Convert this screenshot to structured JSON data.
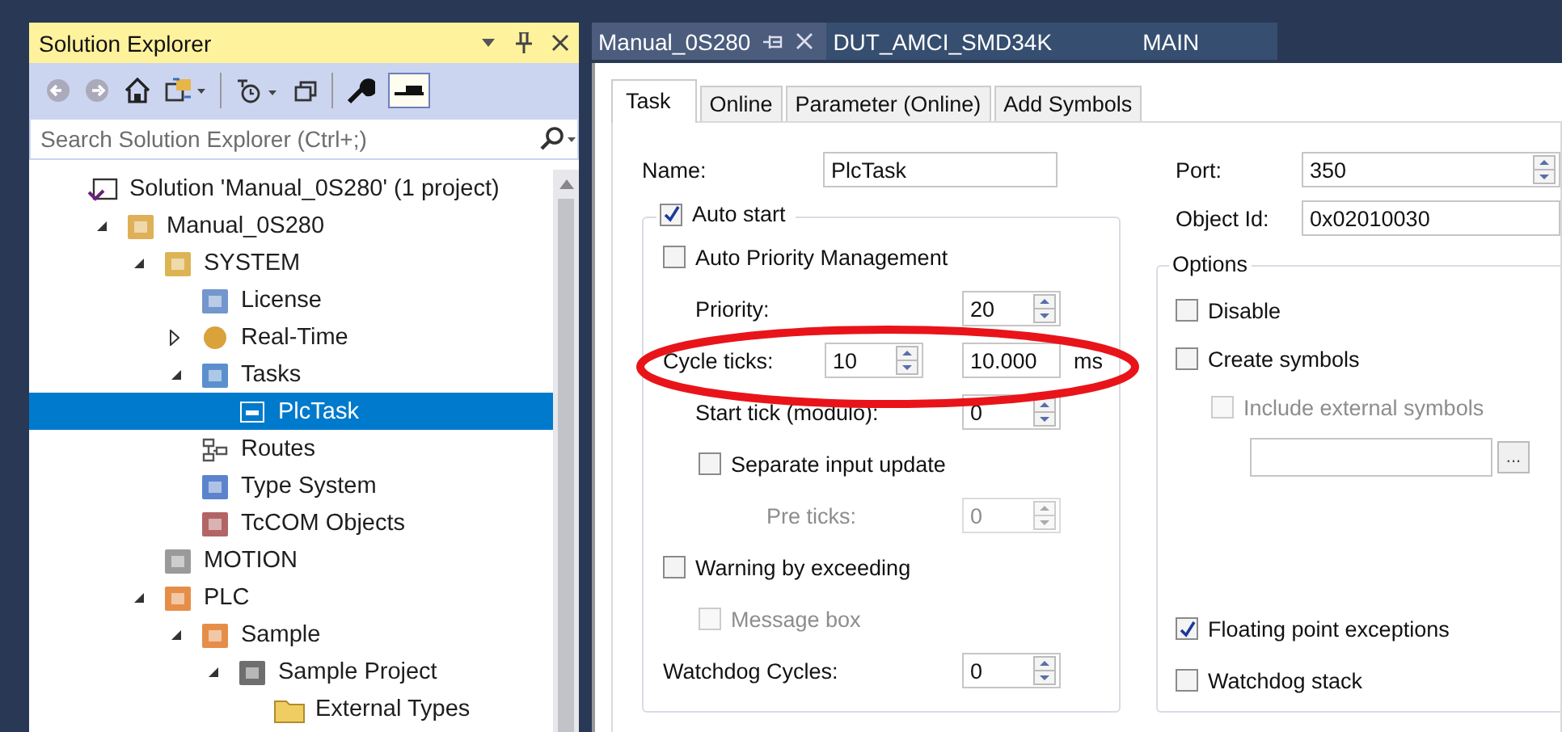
{
  "solution_explorer": {
    "title": "Solution Explorer",
    "search": {
      "placeholder": "Search Solution Explorer (Ctrl+;)"
    },
    "tree": [
      {
        "kind": "solution",
        "label": "Solution 'Manual_0S280' (1 project)",
        "selected": false,
        "children": [
          {
            "kind": "project",
            "label": "Manual_0S280",
            "expanded": true,
            "selected": false,
            "children": [
              {
                "kind": "system",
                "label": "SYSTEM",
                "expanded": true,
                "selected": false,
                "children": [
                  {
                    "kind": "license",
                    "label": "License",
                    "selected": false
                  },
                  {
                    "kind": "realtime",
                    "label": "Real-Time",
                    "expanded": false,
                    "selected": false
                  },
                  {
                    "kind": "tasks",
                    "label": "Tasks",
                    "expanded": true,
                    "selected": false,
                    "children": [
                      {
                        "kind": "task",
                        "label": "PlcTask",
                        "selected": true
                      }
                    ]
                  },
                  {
                    "kind": "routes",
                    "label": "Routes",
                    "selected": false
                  },
                  {
                    "kind": "types",
                    "label": "Type System",
                    "selected": false
                  },
                  {
                    "kind": "tccom",
                    "label": "TcCOM Objects",
                    "selected": false
                  }
                ]
              },
              {
                "kind": "motion",
                "label": "MOTION",
                "selected": false
              },
              {
                "kind": "plc",
                "label": "PLC",
                "expanded": true,
                "selected": false,
                "children": [
                  {
                    "kind": "plc",
                    "label": "Sample",
                    "expanded": true,
                    "selected": false,
                    "children": [
                      {
                        "kind": "plcproject",
                        "label": "Sample Project",
                        "expanded": true,
                        "selected": false,
                        "children": [
                          {
                            "kind": "folder",
                            "label": "External Types",
                            "selected": false
                          }
                        ]
                      }
                    ]
                  }
                ]
              }
            ]
          }
        ]
      }
    ]
  },
  "document_tabs": [
    {
      "label": "Manual_0S280",
      "selected": true
    },
    {
      "label": "DUT_AMCI_SMD34K",
      "selected": false
    },
    {
      "label": "MAIN",
      "selected": false
    }
  ],
  "dialog_tabs": [
    {
      "label": "Task",
      "selected": true
    },
    {
      "label": "Online",
      "selected": false
    },
    {
      "label": "Parameter (Online)",
      "selected": false
    },
    {
      "label": "Add Symbols",
      "selected": false
    }
  ],
  "task": {
    "name": {
      "label": "Name:",
      "value": "PlcTask"
    },
    "auto_start": {
      "label": "Auto start",
      "checked": true
    },
    "rows": [
      {
        "kind": "check",
        "label": "Auto Priority Management",
        "checked": false,
        "disabled": false
      },
      {
        "kind": "subspin",
        "label": "Priority:",
        "value": "20",
        "disabled": false
      },
      {
        "kind": "cycle",
        "label": "Cycle ticks:",
        "value": "10",
        "time": "10.000",
        "unit": "ms",
        "disabled": false
      },
      {
        "kind": "subspin",
        "label": "Start tick (modulo):",
        "value": "0",
        "disabled": false
      },
      {
        "kind": "subcheck",
        "label": "Separate input update",
        "checked": false,
        "disabled": false,
        "children": [
          {
            "kind": "spin",
            "label": "Pre ticks:",
            "value": "0",
            "disabled": true
          }
        ]
      },
      {
        "kind": "check",
        "label": "Warning by exceeding",
        "checked": false,
        "disabled": false,
        "children": [
          {
            "kind": "check",
            "label": "Message box",
            "checked": false,
            "disabled": true
          }
        ]
      },
      {
        "kind": "spin",
        "label": "Watchdog Cycles:",
        "value": "0",
        "disabled": false
      }
    ]
  },
  "port": {
    "label": "Port:",
    "value": "350"
  },
  "object_id": {
    "label": "Object Id:",
    "value": "0x02010030"
  },
  "options": {
    "title": "Options",
    "items": [
      {
        "kind": "check",
        "label": "Disable",
        "checked": false,
        "disabled": false
      },
      {
        "kind": "check",
        "label": "Create symbols",
        "checked": false,
        "disabled": false,
        "children": [
          {
            "kind": "check",
            "label": "Include external symbols",
            "checked": false,
            "disabled": true
          },
          {
            "kind": "browse",
            "browse_label": "...",
            "disabled": false
          }
        ]
      }
    ],
    "footer_items": [
      {
        "kind": "check",
        "label": "Floating point exceptions",
        "checked": true,
        "disabled": false
      },
      {
        "kind": "check",
        "label": "Watchdog stack",
        "checked": false,
        "disabled": false
      }
    ]
  }
}
